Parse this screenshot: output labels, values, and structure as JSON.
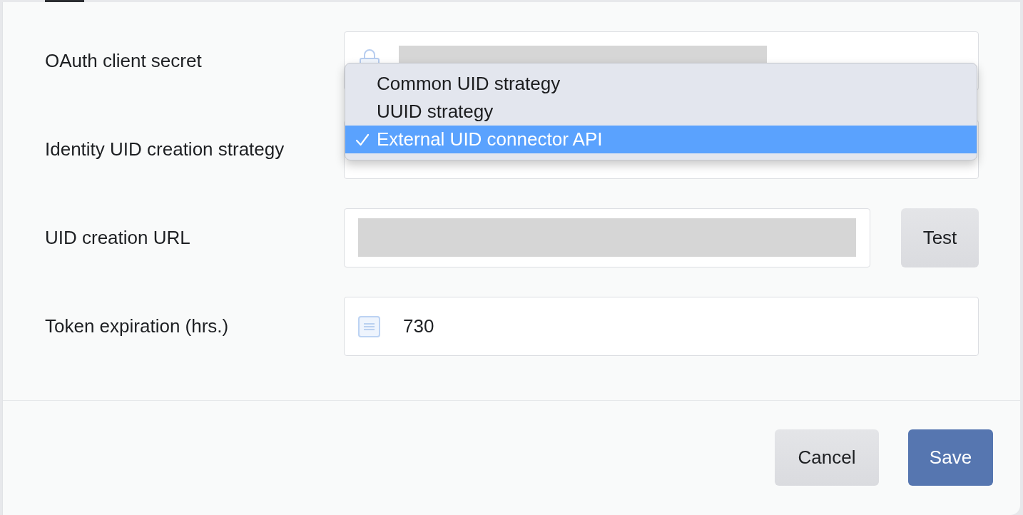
{
  "form": {
    "fields": [
      {
        "kind": "secret",
        "label": "OAuth client secret"
      },
      {
        "kind": "select",
        "label": "Identity UID creation strategy",
        "expanded": true,
        "options": [
          {
            "label": "Common UID strategy",
            "selected": false
          },
          {
            "label": "UUID strategy",
            "selected": false
          },
          {
            "label": "External UID connector API",
            "selected": true
          }
        ]
      },
      {
        "kind": "url",
        "label": "UID creation URL",
        "button": "Test"
      },
      {
        "kind": "number",
        "label": "Token expiration (hrs.)",
        "value": "730"
      }
    ]
  },
  "footer": {
    "buttons": [
      {
        "label": "Cancel",
        "kind": "secondary"
      },
      {
        "label": "Save",
        "kind": "primary"
      }
    ]
  }
}
